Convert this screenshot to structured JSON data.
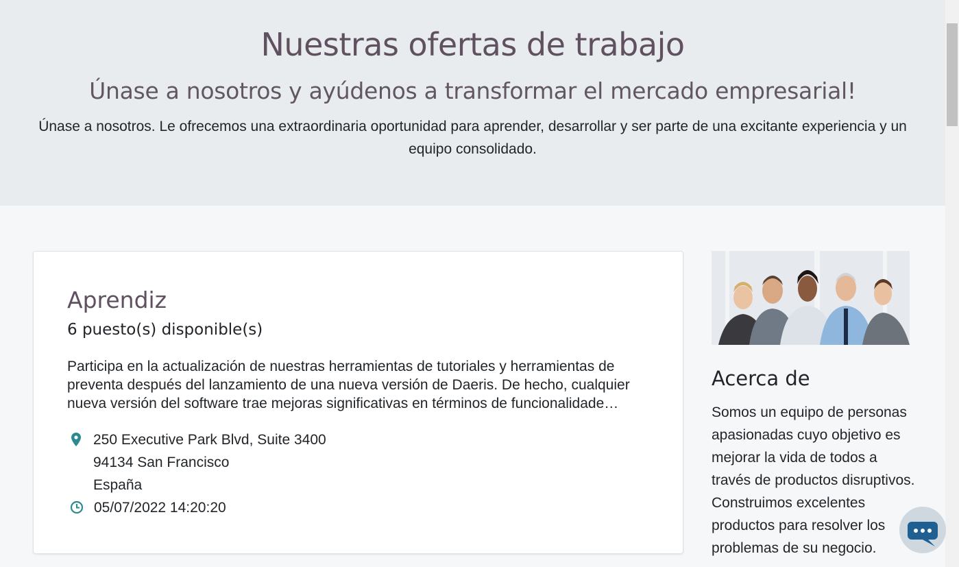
{
  "hero": {
    "title": "Nuestras ofertas de trabajo",
    "subtitle": "Únase a nosotros y ayúdenos a transformar el mercado empresarial!",
    "text": "Únase a nosotros. Le ofrecemos una extraordinaria oportunidad para aprender, desarrollar y ser parte de una excitante experiencia y un equipo consolidado."
  },
  "job": {
    "title": "Aprendiz",
    "openings": "6 puesto(s) disponible(s)",
    "description": "Participa en la actualización de nuestras herramientas de tutoriales y herramientas de preventa después del lanzamiento de una nueva versión de Daeris. De hecho, cualquier nueva versión del software trae mejoras significativas en términos de funcionalidade…",
    "address_line1": "250 Executive Park Blvd, Suite 3400",
    "address_line2": "94134 San Francisco",
    "address_line3": "España",
    "date": "05/07/2022 14:20:20"
  },
  "sidebar": {
    "about_title": "Acerca de",
    "about_text": "Somos un equipo de personas apasionadas cuyo objetivo es mejorar la vida de todos a través de productos disruptivos. Construimos excelentes productos para resolver los problemas de su negocio."
  },
  "icons": {
    "location": "map-marker-icon",
    "clock": "clock-icon",
    "chat": "chat-bubble-icon"
  },
  "colors": {
    "accent": "#2b8a8f",
    "heading": "#5f5160",
    "hero_bg": "#e9ecef"
  }
}
